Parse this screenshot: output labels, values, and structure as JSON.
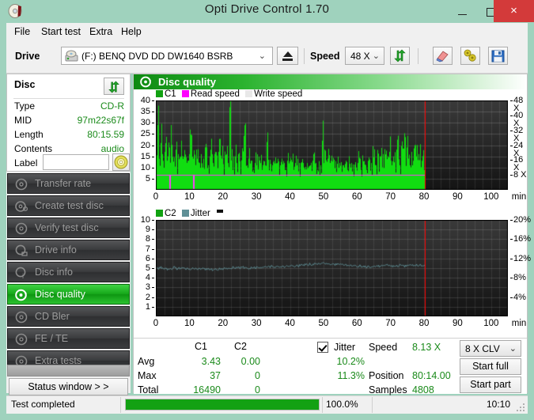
{
  "window": {
    "title": "Opti Drive Control 1.70",
    "icon": "disc-icon",
    "minimize_label": "–",
    "maximize_label": "□",
    "close_label": "×"
  },
  "menubar": {
    "items": [
      {
        "label": "File",
        "name": "menu-file"
      },
      {
        "label": "Start test",
        "name": "menu-start-test"
      },
      {
        "label": "Extra",
        "name": "menu-extra"
      },
      {
        "label": "Help",
        "name": "menu-help"
      }
    ]
  },
  "toolbar": {
    "drive_label": "Drive",
    "drive_value": "(F:)   BENQ DVD DD DW1640 BSRB",
    "drive_chevron": "⌄",
    "eject_title": "Eject",
    "speed_label": "Speed",
    "speed_value": "48 X",
    "speed_chevron": "⌄",
    "refresh_icon": "refresh-arrows-icon",
    "erase_icon": "eraser-icon",
    "tools_icon": "tools-icon",
    "save_icon": "floppy-save-icon"
  },
  "disc_panel": {
    "title": "Disc",
    "refresh_icon": "refresh-arrows-icon",
    "rows": [
      {
        "key": "Type",
        "value": "CD-R"
      },
      {
        "key": "MID",
        "value": "97m22s67f"
      },
      {
        "key": "Length",
        "value": "80:15.59"
      },
      {
        "key": "Contents",
        "value": "audio"
      }
    ],
    "label_key": "Label",
    "label_value": "",
    "label_placeholder": "",
    "disc_button_icon": "cd-disc-icon"
  },
  "sidebar": {
    "items": [
      {
        "label": "Transfer rate",
        "icon": "disc-icon",
        "active": false
      },
      {
        "label": "Create test disc",
        "icon": "disc-write-icon",
        "active": false
      },
      {
        "label": "Verify test disc",
        "icon": "disc-check-icon",
        "active": false
      },
      {
        "label": "Drive info",
        "icon": "drive-info-icon",
        "active": false
      },
      {
        "label": "Disc info",
        "icon": "disc-info-icon",
        "active": false
      },
      {
        "label": "Disc quality",
        "icon": "disc-quality-icon",
        "active": true
      },
      {
        "label": "CD Bler",
        "icon": "disc-icon",
        "active": false
      },
      {
        "label": "FE / TE",
        "icon": "disc-icon",
        "active": false
      },
      {
        "label": "Extra tests",
        "icon": "disc-icon",
        "active": false
      }
    ],
    "status_window_label": "Status window > >"
  },
  "content": {
    "header_title": "Disc quality",
    "header_icon": "disc-quality-icon"
  },
  "chart_data": [
    {
      "type": "bar",
      "name": "c1-chart",
      "title": "",
      "legend": [
        {
          "label": "C1",
          "color": "#11a111"
        },
        {
          "label": "Read speed",
          "color": "#ff00ff"
        },
        {
          "label": "Write speed",
          "color": "#e8e8e8"
        }
      ],
      "legend_position": "top-left",
      "grid": true,
      "xlabel": "min",
      "xlim": [
        0,
        105
      ],
      "xticks": [
        0,
        10,
        20,
        30,
        40,
        50,
        60,
        70,
        80,
        90,
        100
      ],
      "xticklabels": [
        "0",
        "10",
        "20",
        "30",
        "40",
        "50",
        "60",
        "70",
        "80",
        "90",
        "100"
      ],
      "ylabel": "",
      "ylim": [
        0,
        40
      ],
      "yticks": [
        5,
        10,
        15,
        20,
        25,
        30,
        35,
        40
      ],
      "yticklabels": [
        "5",
        "10",
        "15",
        "20",
        "25",
        "30",
        "35",
        "40"
      ],
      "y2label": "",
      "y2lim": [
        0,
        48
      ],
      "y2ticks": [
        8,
        16,
        24,
        32,
        40,
        48
      ],
      "y2ticklabels": [
        "8 X",
        "16 X",
        "24 X",
        "32 X",
        "40 X",
        "48 X"
      ],
      "read_speed_level": 8.13,
      "data_end_min": 80.23,
      "marker_line_min": 80.23,
      "marker_color": "#ff0000",
      "baseline_fill": 6,
      "values": [
        11,
        29,
        14,
        21,
        16,
        13,
        17,
        12,
        15,
        19,
        27,
        14,
        12,
        18,
        11,
        16,
        13,
        22,
        12,
        15,
        10,
        13,
        16,
        27,
        12,
        14,
        11,
        18,
        13,
        12,
        16,
        10,
        14,
        19,
        13,
        11,
        15,
        21,
        12,
        16,
        13,
        10,
        17,
        12,
        14,
        11,
        13,
        16,
        12,
        37,
        18,
        13,
        11,
        15,
        12,
        16,
        10,
        13,
        17,
        24,
        12,
        11,
        14,
        10,
        13,
        9,
        12,
        11,
        14,
        10,
        12,
        9,
        13,
        11,
        19,
        10,
        12,
        9,
        11,
        13,
        10,
        12,
        9,
        11,
        14,
        10,
        12,
        9,
        13,
        11,
        10,
        12,
        9,
        11,
        10,
        13,
        9,
        12,
        11,
        10,
        9,
        12,
        10,
        11,
        9,
        13,
        10,
        12,
        9,
        11,
        10,
        22,
        12,
        18,
        11,
        14,
        10,
        13,
        11,
        12,
        9,
        11,
        10,
        12,
        9,
        11,
        10,
        13,
        9,
        11,
        10,
        12,
        9,
        11,
        10,
        12,
        11,
        9,
        12,
        10,
        11,
        9,
        13,
        10,
        12,
        19,
        14,
        11,
        13,
        10,
        15,
        12,
        16,
        11,
        14,
        12,
        17,
        13,
        11,
        15,
        12,
        18,
        14,
        11,
        16,
        13,
        21,
        12,
        19,
        14,
        11,
        17,
        13,
        20,
        15,
        12,
        16,
        11,
        13,
        10
      ]
    },
    {
      "type": "line",
      "name": "c2-jitter-chart",
      "title": "",
      "legend": [
        {
          "label": "C2",
          "color": "#11a111"
        },
        {
          "label": "Jitter",
          "color": "#5f8f96"
        }
      ],
      "legend_position": "top-left",
      "grid": true,
      "xlabel": "min",
      "xlim": [
        0,
        105
      ],
      "xticks": [
        0,
        10,
        20,
        30,
        40,
        50,
        60,
        70,
        80,
        90,
        100
      ],
      "xticklabels": [
        "0",
        "10",
        "20",
        "30",
        "40",
        "50",
        "60",
        "70",
        "80",
        "90",
        "100"
      ],
      "ylabel": "",
      "ylim": [
        0,
        10
      ],
      "yticks": [
        1,
        2,
        3,
        4,
        5,
        6,
        7,
        8,
        9,
        10
      ],
      "yticklabels": [
        "1",
        "2",
        "3",
        "4",
        "5",
        "6",
        "7",
        "8",
        "9",
        "10"
      ],
      "y2label": "",
      "y2lim": [
        0,
        20
      ],
      "y2ticks": [
        4,
        8,
        12,
        16,
        20
      ],
      "y2ticklabels": [
        "4%",
        "8%",
        "12%",
        "16%",
        "20%"
      ],
      "c2_values_all_zero": true,
      "data_end_min": 80.23,
      "marker_line_min": 80.23,
      "marker_color": "#ff0000",
      "jitter_series": [
        5.05,
        4.95,
        5.1,
        4.9,
        5.05,
        4.88,
        5.02,
        4.95,
        5.08,
        4.92,
        5.0,
        4.9,
        5.05,
        4.95,
        5.0,
        4.88,
        4.95,
        5.02,
        4.9,
        4.98,
        4.92,
        5.0,
        4.86,
        4.95,
        4.88,
        4.82,
        4.9,
        4.85,
        4.95,
        4.88,
        5.0,
        4.92,
        5.05,
        4.95,
        5.08,
        5.0,
        5.1,
        5.02,
        5.12,
        5.05,
        5.0,
        4.95,
        5.05,
        5.12,
        5.02,
        5.1,
        5.05,
        5.15,
        5.08,
        5.18,
        5.1,
        5.2,
        5.12,
        5.05,
        5.15,
        5.08,
        5.18,
        5.1,
        5.22,
        5.15,
        5.25,
        5.18,
        5.3,
        5.22,
        5.35,
        5.28,
        5.4,
        5.32,
        5.45,
        5.35,
        5.5,
        5.4,
        5.55,
        5.45,
        5.52,
        5.42,
        5.48,
        5.38,
        5.45,
        5.35,
        5.42,
        5.32,
        5.38,
        5.28,
        5.35,
        5.25,
        5.32,
        5.22,
        5.28,
        5.18,
        5.25,
        5.15,
        5.2,
        5.1,
        5.18,
        5.08,
        5.22,
        5.12,
        5.28,
        5.15,
        5.3,
        5.2,
        5.35,
        5.22,
        5.28,
        5.18,
        5.32,
        5.22,
        5.35,
        5.25,
        5.2,
        5.3,
        5.22,
        5.35,
        5.25,
        5.38,
        5.28,
        5.32,
        5.22,
        5.28
      ]
    }
  ],
  "stats": {
    "col_headers": [
      "C1",
      "C2"
    ],
    "jitter_label": "Jitter",
    "jitter_checked": true,
    "rows": [
      {
        "label": "Avg",
        "c1": "3.43",
        "c2": "0.00",
        "jitter": "10.2%"
      },
      {
        "label": "Max",
        "c1": "37",
        "c2": "0",
        "jitter": "11.3%"
      },
      {
        "label": "Total",
        "c1": "16490",
        "c2": "0",
        "jitter": ""
      }
    ],
    "speed_label": "Speed",
    "speed_value": "8.13 X",
    "position_label": "Position",
    "position_value": "80:14.00",
    "samples_label": "Samples",
    "samples_value": "4808",
    "clv_value": "8 X CLV",
    "clv_chevron": "⌄",
    "start_full_label": "Start full",
    "start_part_label": "Start part"
  },
  "statusbar": {
    "message": "Test completed",
    "progress_percent": 100.0,
    "progress_text": "100.0%",
    "elapsed": "10:10"
  }
}
